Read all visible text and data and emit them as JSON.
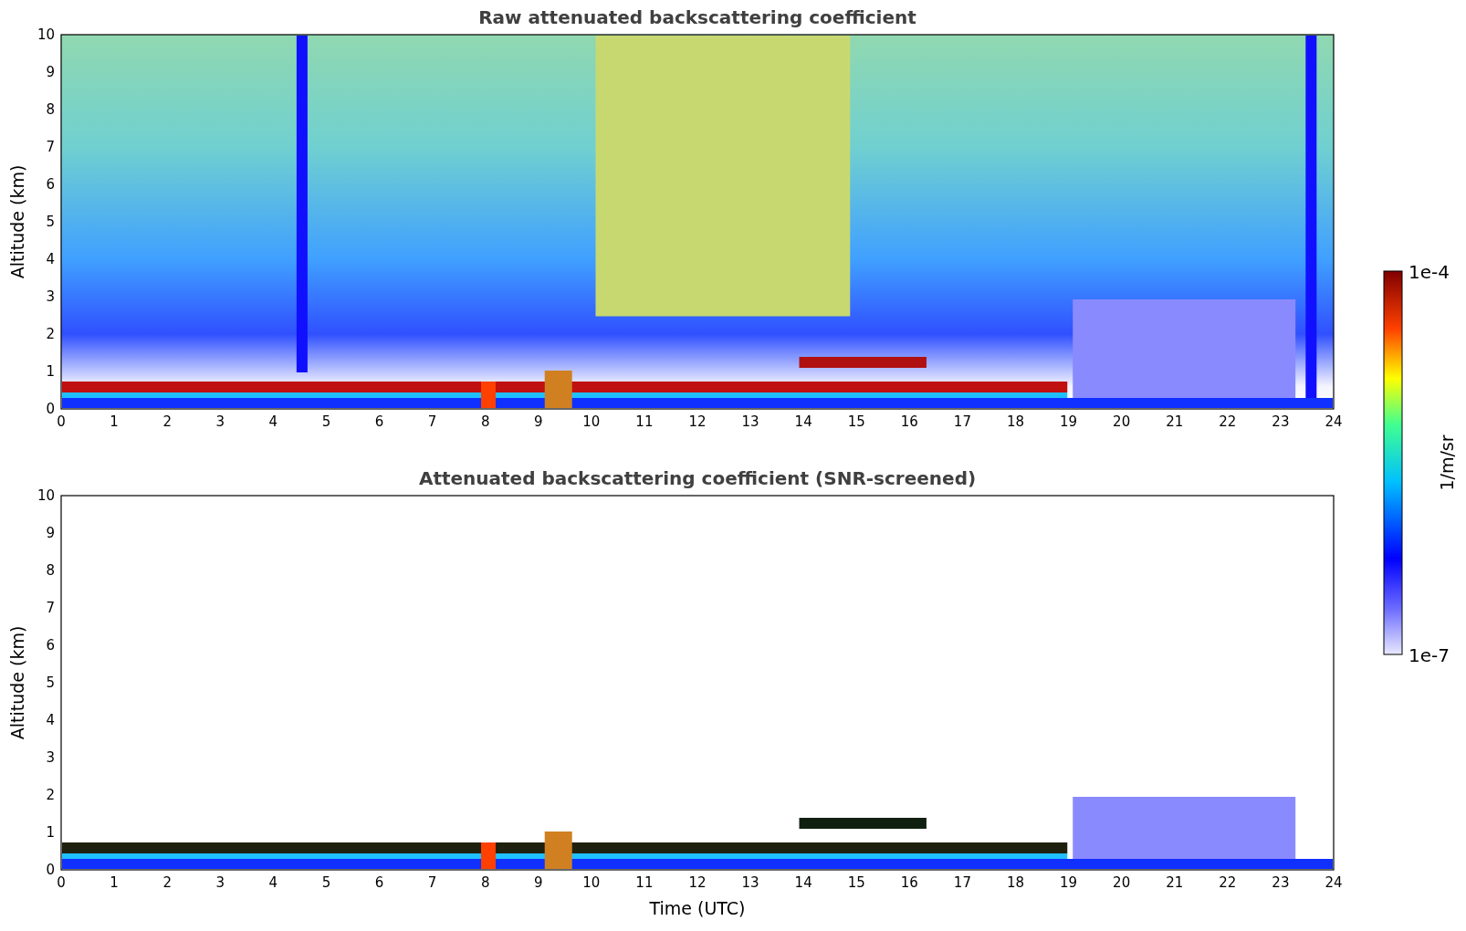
{
  "panels": [
    {
      "kind": "raw",
      "title": "Raw attenuated backscattering coefficient",
      "ylabel": "Altitude (km)",
      "yticks": [
        "10",
        "9",
        "8",
        "7",
        "6",
        "5",
        "4",
        "3",
        "2",
        "1",
        "0"
      ],
      "xticks": [
        "0",
        "1",
        "2",
        "3",
        "4",
        "5",
        "6",
        "7",
        "8",
        "9",
        "10",
        "11",
        "12",
        "13",
        "14",
        "15",
        "16",
        "17",
        "18",
        "19",
        "20",
        "21",
        "22",
        "23",
        "24"
      ]
    },
    {
      "kind": "screened",
      "title": "Attenuated backscattering coefficient (SNR-screened)",
      "ylabel": "Altitude (km)",
      "yticks": [
        "10",
        "9",
        "8",
        "7",
        "6",
        "5",
        "4",
        "3",
        "2",
        "1",
        "0"
      ],
      "xticks": [
        "0",
        "1",
        "2",
        "3",
        "4",
        "5",
        "6",
        "7",
        "8",
        "9",
        "10",
        "11",
        "12",
        "13",
        "14",
        "15",
        "16",
        "17",
        "18",
        "19",
        "20",
        "21",
        "22",
        "23",
        "24"
      ],
      "xlabel": "Time (UTC)"
    }
  ],
  "colorbar": {
    "max_label": "1e-4",
    "min_label": "1e-7",
    "label": "1/m/sr"
  }
}
